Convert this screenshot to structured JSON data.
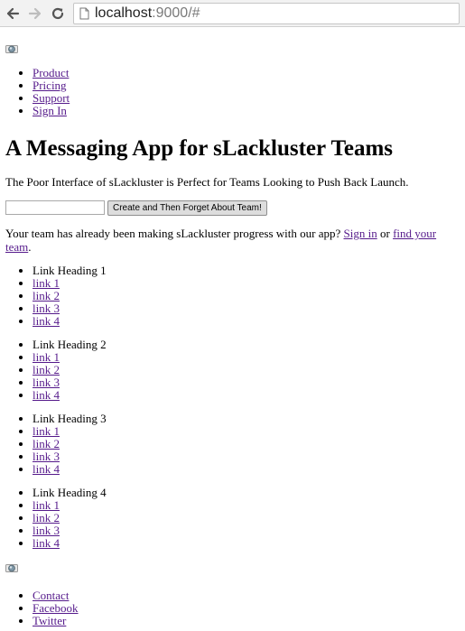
{
  "browser": {
    "url_host": "localhost",
    "url_rest": ":9000/#"
  },
  "nav": {
    "items": [
      {
        "label": "Product"
      },
      {
        "label": "Pricing"
      },
      {
        "label": "Support"
      },
      {
        "label": "Sign In"
      }
    ]
  },
  "hero": {
    "title": "A Messaging App for sLackluster Teams",
    "tagline": "The Poor Interface of sLackluster is Perfect for Teams Looking to Push Back Launch.",
    "input_value": "",
    "button_label": "Create and Then Forget About Team!",
    "already_prefix": "Your team has already been making sLackluster progress with our app? ",
    "sign_in_link": "Sign in",
    "or_text": " or ",
    "find_team_link": "find your team",
    "period": "."
  },
  "link_groups": [
    {
      "heading": "Link Heading 1",
      "links": [
        "link 1",
        "link 2",
        "link 3",
        "link 4"
      ]
    },
    {
      "heading": "Link Heading 2",
      "links": [
        "link 1",
        "link 2",
        "link 3",
        "link 4"
      ]
    },
    {
      "heading": "Link Heading 3",
      "links": [
        "link 1",
        "link 2",
        "link 3",
        "link 4"
      ]
    },
    {
      "heading": "Link Heading 4",
      "links": [
        "link 1",
        "link 2",
        "link 3",
        "link 4"
      ]
    }
  ],
  "footer": {
    "items": [
      {
        "label": "Contact"
      },
      {
        "label": "Facebook"
      },
      {
        "label": "Twitter"
      }
    ]
  },
  "colors": {
    "link": "#551a8b"
  }
}
